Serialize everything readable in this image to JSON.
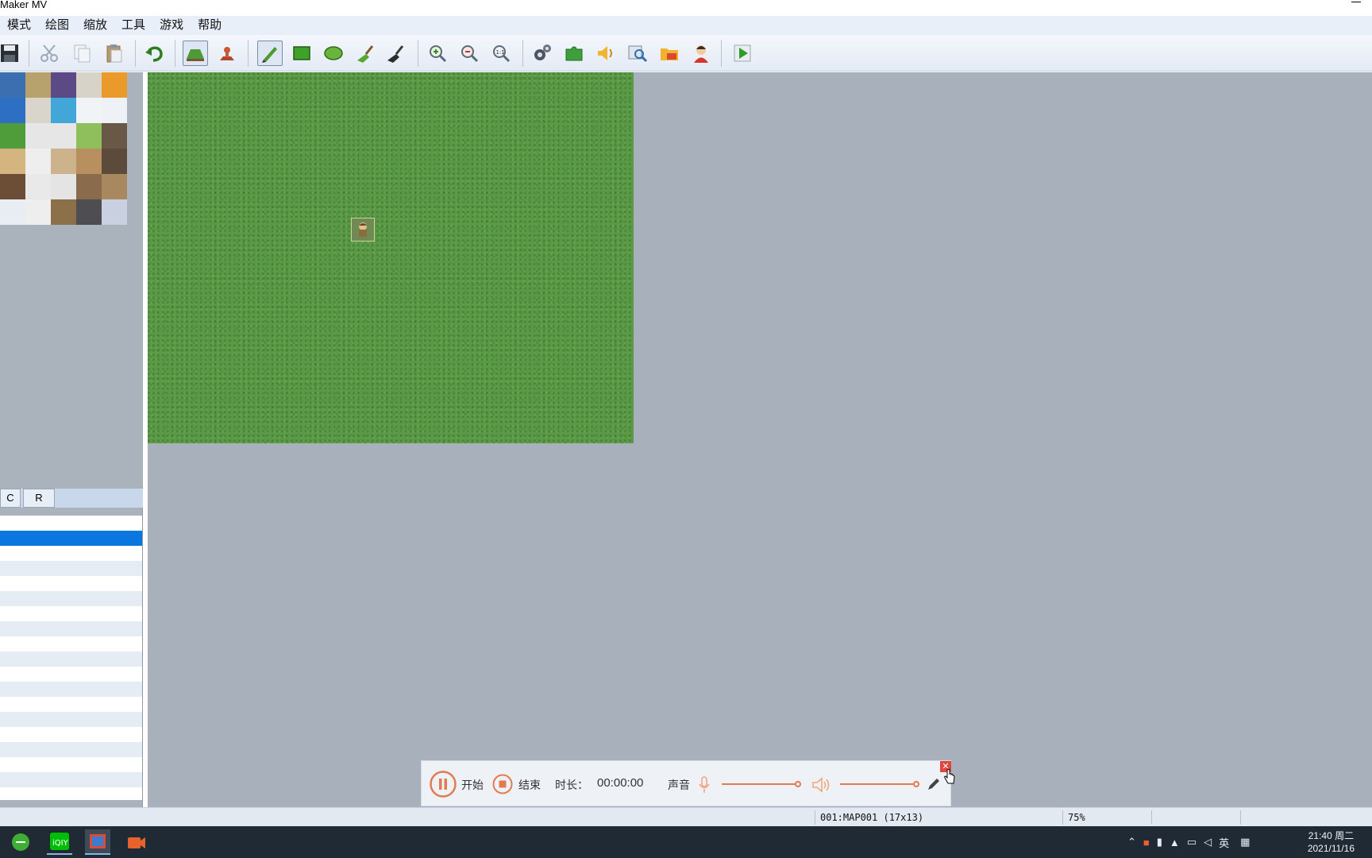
{
  "window": {
    "title": "Maker MV"
  },
  "menu": [
    "模式",
    "绘图",
    "缩放",
    "工具",
    "游戏",
    "帮助"
  ],
  "toolbar": {
    "tools": [
      "save-icon",
      "cut-icon",
      "copy-icon",
      "paste-icon",
      "undo-icon",
      "map-mode-icon",
      "event-mode-icon",
      "pencil-icon",
      "rectangle-icon",
      "ellipse-icon",
      "flood-fill-icon",
      "shadow-pen-icon",
      "zoom-in-icon",
      "zoom-out-icon",
      "actual-size-icon",
      "database-icon",
      "plugin-manager-icon",
      "sound-test-icon",
      "event-searcher-icon",
      "resource-manager-icon",
      "character-generator-icon",
      "playtest-icon"
    ]
  },
  "tileset": {
    "tabs": [
      "C",
      "R"
    ]
  },
  "recorder": {
    "start_label": "开始",
    "stop_label": "结束",
    "duration_label": "时长：",
    "duration_value": "00:00:00",
    "sound_label": "声音",
    "mic_level": 1.0,
    "speaker_level": 1.0
  },
  "status": {
    "map_info": "001:MAP001 (17x13)",
    "zoom": "75%"
  },
  "taskbar": {
    "apps": [
      "browser-icon",
      "iqiyi-icon",
      "rpg-maker-icon",
      "recorder-app-icon"
    ],
    "ime": "英",
    "time": "21:40 周二",
    "date": "2021/11/16"
  },
  "colors": {
    "selection": "#0a76e0",
    "canvas_bg": "#a8b1bb",
    "grass": "#5a9a46",
    "recorder_accent": "#e27b4f"
  }
}
